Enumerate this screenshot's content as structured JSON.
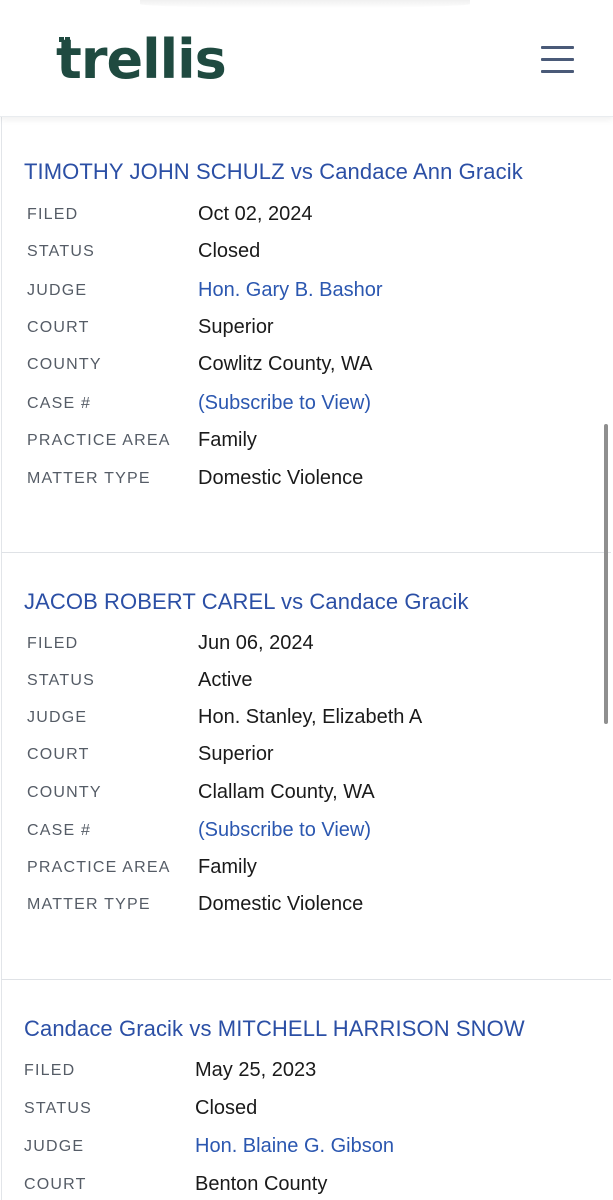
{
  "header": {
    "logo_text": "trellis",
    "logo_color": "#1f4a40",
    "menu_icon": "hamburger-menu-icon"
  },
  "cases": [
    {
      "title": "TIMOTHY JOHN SCHULZ vs Candace Ann Gracik",
      "fields": [
        {
          "label": "FILED",
          "value": "Oct 02, 2024",
          "link": false
        },
        {
          "label": "STATUS",
          "value": "Closed",
          "link": false
        },
        {
          "label": "JUDGE",
          "value": "Hon. Gary B. Bashor",
          "link": true
        },
        {
          "label": "COURT",
          "value": "Superior",
          "link": false
        },
        {
          "label": "COUNTY",
          "value": "Cowlitz County, WA",
          "link": false
        },
        {
          "label": "CASE #",
          "value": "(Subscribe to View)",
          "link": true
        },
        {
          "label": "PRACTICE AREA",
          "value": "Family",
          "link": false
        },
        {
          "label": "MATTER TYPE",
          "value": "Domestic Violence",
          "link": false
        }
      ]
    },
    {
      "title": "JACOB ROBERT CAREL vs Candace Gracik",
      "fields": [
        {
          "label": "FILED",
          "value": "Jun 06, 2024",
          "link": false
        },
        {
          "label": "STATUS",
          "value": "Active",
          "link": false
        },
        {
          "label": "JUDGE",
          "value": "Hon. Stanley, Elizabeth A",
          "link": false
        },
        {
          "label": "COURT",
          "value": "Superior",
          "link": false
        },
        {
          "label": "COUNTY",
          "value": "Clallam County, WA",
          "link": false
        },
        {
          "label": "CASE #",
          "value": "(Subscribe to View)",
          "link": true
        },
        {
          "label": "PRACTICE AREA",
          "value": "Family",
          "link": false
        },
        {
          "label": "MATTER TYPE",
          "value": "Domestic Violence",
          "link": false
        }
      ]
    },
    {
      "title": "Candace Gracik vs MITCHELL HARRISON SNOW",
      "fields": [
        {
          "label": "FILED",
          "value": "May 25, 2023",
          "link": false
        },
        {
          "label": "STATUS",
          "value": "Closed",
          "link": false
        },
        {
          "label": "JUDGE",
          "value": "Hon. Blaine G. Gibson",
          "link": true
        },
        {
          "label": "COURT",
          "value": "Benton County",
          "link": false
        }
      ]
    }
  ],
  "colors": {
    "title_link": "#2b4fa5",
    "value_link": "#2b57b0",
    "label": "#555c66",
    "text": "#1a1a1a"
  }
}
